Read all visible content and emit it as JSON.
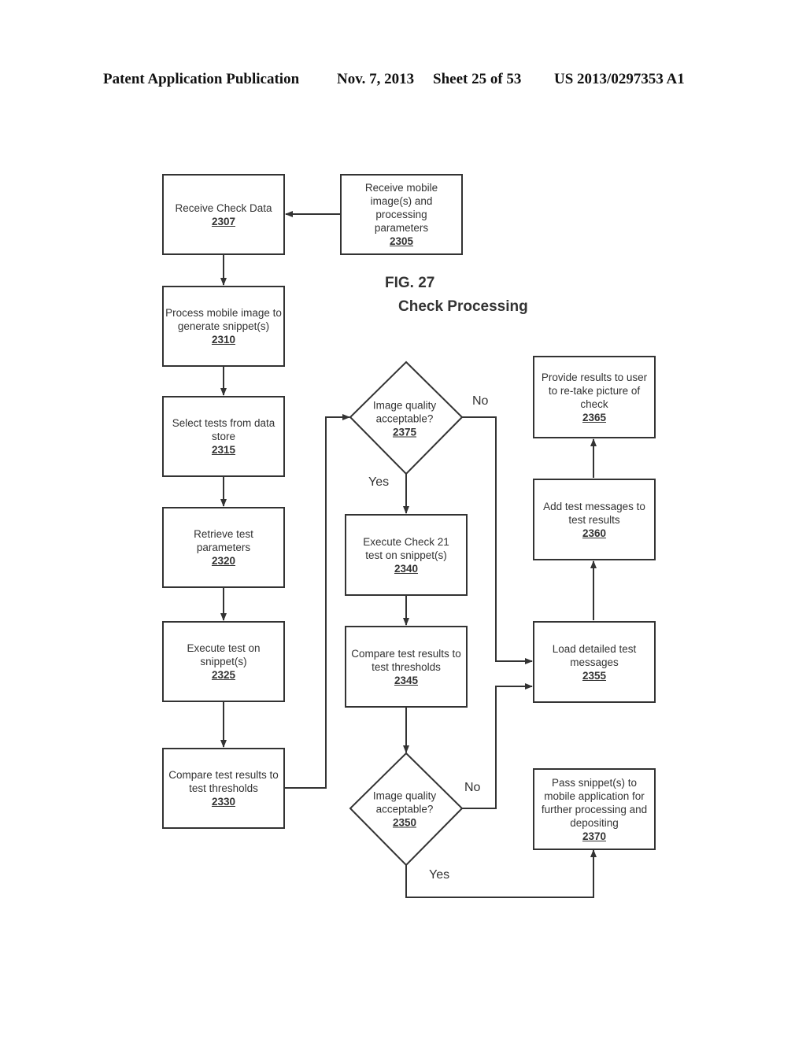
{
  "header": {
    "left": "Patent Application Publication",
    "date": "Nov. 7, 2013",
    "sheet": "Sheet 25 of 53",
    "number": "US 2013/0297353 A1"
  },
  "figure": {
    "label": "FIG. 27",
    "title": "Check Processing"
  },
  "nodes": {
    "n2307": {
      "text": "Receive Check Data",
      "ref": "2307"
    },
    "n2305": {
      "text": "Receive mobile image(s)  and processing parameters",
      "ref": "2305"
    },
    "n2310": {
      "text": "Process mobile image to generate snippet(s)",
      "ref": "2310"
    },
    "n2315": {
      "text": "Select tests from data store",
      "ref": "2315"
    },
    "n2320": {
      "text": "Retrieve test parameters",
      "ref": "2320"
    },
    "n2325": {
      "text": "Execute test on snippet(s)",
      "ref": "2325"
    },
    "n2330": {
      "text": "Compare test results to test thresholds",
      "ref": "2330"
    },
    "n2375": {
      "text": "Image quality acceptable?",
      "ref": "2375"
    },
    "n2340": {
      "text": "Execute Check 21 test on snippet(s)",
      "ref": "2340"
    },
    "n2345": {
      "text": "Compare test results to test thresholds",
      "ref": "2345"
    },
    "n2350": {
      "text": "Image quality acceptable?",
      "ref": "2350"
    },
    "n2355": {
      "text": "Load detailed test messages",
      "ref": "2355"
    },
    "n2360": {
      "text": "Add test messages to test results",
      "ref": "2360"
    },
    "n2365": {
      "text": "Provide results to user to re-take picture of check",
      "ref": "2365"
    },
    "n2370": {
      "text": "Pass snippet(s) to mobile application for further processing and depositing",
      "ref": "2370"
    }
  },
  "edge_labels": {
    "no_2375": "No",
    "yes_2375": "Yes",
    "no_2350": "No",
    "yes_2350": "Yes"
  }
}
